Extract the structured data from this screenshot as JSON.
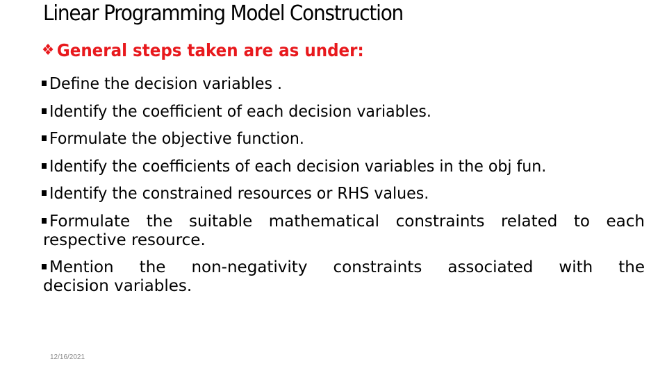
{
  "slide": {
    "title": "Linear Programming Model Construction",
    "subheading": {
      "icon": "diamond-bullet-icon",
      "icon_glyph": "❖",
      "text": "General steps taken are as under:",
      "color": "#e8191d"
    },
    "steps": [
      {
        "text": " Define the decision variables ."
      },
      {
        "text": "Identify the coefficient of each decision variables."
      },
      {
        "text": "Formulate the objective function."
      },
      {
        "text": "Identify the coefficients of each decision variables in the obj fun."
      },
      {
        "text": "Identify the constrained resources or RHS values."
      },
      {
        "words": [
          "Formulate",
          "the",
          "suitable",
          "mathematical",
          "constraints",
          "related",
          "to",
          "each"
        ],
        "continuation": "respective resource."
      },
      {
        "words": [
          "Mention",
          "the",
          "non-negativity",
          "constraints",
          "associated",
          "with",
          "the"
        ],
        "continuation": "decision variables."
      }
    ],
    "date": "12/16/2021"
  }
}
